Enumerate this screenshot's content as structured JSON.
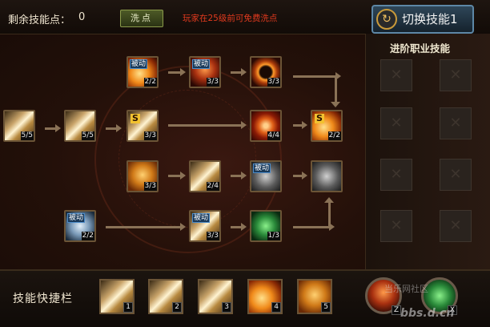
{
  "header": {
    "points_label": "剩余技能点：",
    "points_value": "0",
    "reset_label": "洗点",
    "reset_hint": "玩家在25级前可免费洗点",
    "switch_label": "切换技能1"
  },
  "tree": {
    "skills": [
      {
        "id": "s1",
        "icon": "crescent-slash-icon",
        "level": "5/5",
        "tag": "",
        "glyph": ""
      },
      {
        "id": "s2",
        "icon": "blade-slash-icon",
        "level": "5/5",
        "tag": "",
        "glyph": ""
      },
      {
        "id": "s3",
        "icon": "fire-passive-icon",
        "level": "2/2",
        "tag": "被动",
        "glyph": ""
      },
      {
        "id": "s4",
        "icon": "fire-wing-passive-icon",
        "level": "3/3",
        "tag": "被动",
        "glyph": ""
      },
      {
        "id": "s5",
        "icon": "fire-ring-icon",
        "level": "3/3",
        "tag": "",
        "glyph": ""
      },
      {
        "id": "s6",
        "icon": "sword-strike-icon",
        "level": "3/3",
        "tag": "",
        "glyph": "S"
      },
      {
        "id": "s7",
        "icon": "fire-vortex-icon",
        "level": "4/4",
        "tag": "",
        "glyph": ""
      },
      {
        "id": "s8",
        "icon": "flame-burst-icon",
        "level": "2/2",
        "tag": "",
        "glyph": "S"
      },
      {
        "id": "s9",
        "icon": "shield-icon",
        "level": "3/3",
        "tag": "",
        "glyph": ""
      },
      {
        "id": "s10",
        "icon": "twin-blade-icon",
        "level": "2/4",
        "tag": "",
        "glyph": ""
      },
      {
        "id": "s11",
        "icon": "dark-passive-icon",
        "level": "",
        "tag": "被动",
        "glyph": ""
      },
      {
        "id": "s12",
        "icon": "group-buff-icon",
        "level": "",
        "tag": "",
        "glyph": ""
      },
      {
        "id": "s13",
        "icon": "armor-passive-icon",
        "level": "2/2",
        "tag": "被动",
        "glyph": ""
      },
      {
        "id": "s14",
        "icon": "sword-passive-icon",
        "level": "3/3",
        "tag": "被动",
        "glyph": ""
      },
      {
        "id": "s15",
        "icon": "warrior-stance-icon",
        "level": "1/3",
        "tag": "",
        "glyph": ""
      }
    ]
  },
  "advanced": {
    "title": "进阶职业技能",
    "slots": [
      "locked-slot-icon",
      "locked-slot-icon",
      "locked-slot-icon",
      "locked-slot-icon",
      "locked-slot-icon",
      "locked-slot-icon",
      "locked-slot-icon",
      "locked-slot-icon"
    ]
  },
  "shortcut": {
    "label": "技能快捷栏",
    "slots": [
      {
        "key": "1",
        "icon": "crescent-slash-icon"
      },
      {
        "key": "2",
        "icon": "blade-slash-icon"
      },
      {
        "key": "3",
        "icon": "sword-strike-icon"
      },
      {
        "key": "4",
        "icon": "flame-burst-icon"
      },
      {
        "key": "5",
        "icon": "shield-icon"
      },
      {
        "key": "Z",
        "icon": "fire-gear-icon"
      },
      {
        "key": "X",
        "icon": "green-gear-icon"
      }
    ]
  },
  "watermark": {
    "line1": "当乐网社区",
    "line2": "bbs.d.cn"
  }
}
